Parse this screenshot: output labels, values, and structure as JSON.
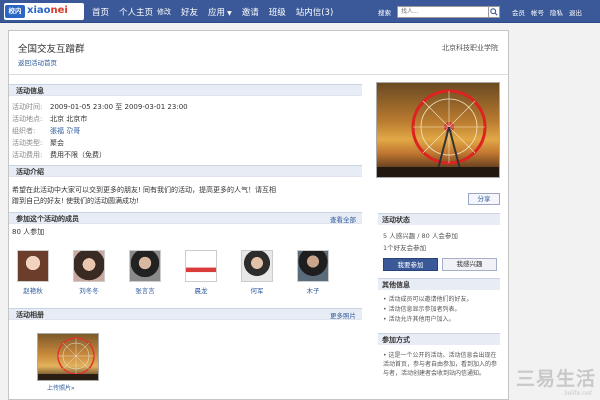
{
  "topbar": {
    "logo_badge": "校内",
    "logo_text_a": "xiao",
    "logo_text_b": "nei",
    "nav": [
      "首页",
      "个人主页",
      "修改",
      "好友",
      "应用",
      "邀请",
      "班级",
      "站内信(3)"
    ],
    "search_label": "搜索",
    "search_placeholder": "找人...",
    "right_links": [
      "会员",
      "帐号",
      "隐私",
      "退出"
    ]
  },
  "header": {
    "title": "全国交友互蹭群",
    "back_link": "返回活动首页",
    "school": "北京科技职业学院"
  },
  "info": {
    "section_title": "活动信息",
    "rows": [
      {
        "label": "活动时间:",
        "value": "2009-01-05 23:00 至 2009-03-01 23:00"
      },
      {
        "label": "活动地点:",
        "value": "北京 北京市"
      },
      {
        "label": "组织者:",
        "value": "張福 尕哥"
      },
      {
        "label": "活动类型:",
        "value": "聚会"
      },
      {
        "label": "活动费用:",
        "value": "费用不限（免费）"
      }
    ]
  },
  "intro": {
    "section_title": "活动介绍",
    "text": "希望在此活动中大家可以交到更多的朋友! 同有我们的活动，提高更多的人气！请互相蹭到自己的好友! 使我们的活动圆满成功!"
  },
  "members": {
    "section_title": "参加这个活动的成员",
    "more": "查看全部",
    "count": "80 人参加",
    "list": [
      {
        "name": "赵艳秋"
      },
      {
        "name": "刘冬冬"
      },
      {
        "name": "张言言"
      },
      {
        "name": "晨龙"
      },
      {
        "name": "何军"
      },
      {
        "name": "木子"
      }
    ]
  },
  "album": {
    "section_title": "活动相册",
    "more": "更多照片",
    "upload": "上传照片»"
  },
  "sidebar": {
    "share": "分享",
    "status_title": "活动状态",
    "status_line1": "5 人感兴趣 / 80 人会参加",
    "status_line2": "1个好友会参加",
    "join_btn": "我要参加",
    "interest_btn": "我感兴趣",
    "other_title": "其他信息",
    "other_items": [
      "• 活动成员可以邀请他们的好友。",
      "• 活动信息显示参加者列表。",
      "• 活动允许其他用户加入。"
    ],
    "mode_title": "参加方式",
    "mode_text": "• 这是一个公开的活动。活动信息会出现在活动首页，参与者自由参加，看到加入的参与者，活动创建者会收到站内信通知。"
  },
  "watermark": {
    "main": "三易生活",
    "sub": "3elife.net"
  },
  "colors": {
    "nav_bg": "#3b5998",
    "section_bg": "#e8ecf4",
    "link": "#2b5a9c"
  }
}
